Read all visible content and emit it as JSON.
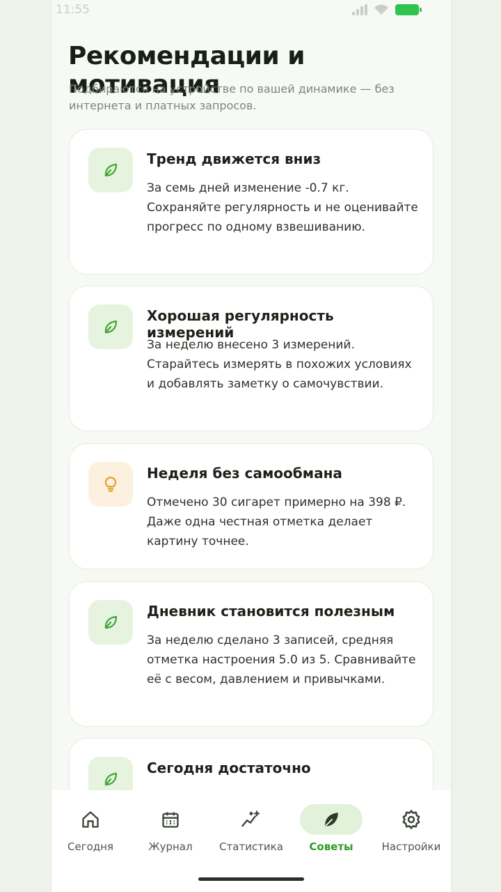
{
  "status": {
    "time": "11:55"
  },
  "page": {
    "title": "Рекомендации и мотивация",
    "subtitle": "Подбираются на устройстве по вашей динамике — без интернета и платных запросов."
  },
  "cards": [
    {
      "icon": "leaf-icon",
      "title": "Тренд движется вниз",
      "text": "За семь дней изменение -0.7 кг. Сохраняйте регулярность и не оценивайте прогресс по одному взвешиванию."
    },
    {
      "icon": "leaf-icon",
      "title": "Хорошая регулярность измерений",
      "text": "За неделю внесено 3 измерений. Старайтесь измерять в похожих условиях и добавлять заметку о самочувствии."
    },
    {
      "icon": "lightbulb-icon",
      "title": "Неделя без самообмана",
      "text": "Отмечено 30 сигарет примерно на 398 ₽. Даже одна честная отметка делает картину точнее."
    },
    {
      "icon": "leaf-icon",
      "title": "Дневник становится полезным",
      "text": "За неделю сделано 3 записей, средняя отметка настроения 5.0 из 5. Сравнивайте её с весом, давлением и привычками."
    },
    {
      "icon": "leaf-icon",
      "title": "Сегодня достаточно",
      "text": ""
    }
  ],
  "nav": [
    {
      "label": "Сегодня",
      "icon": "home-icon"
    },
    {
      "label": "Журнал",
      "icon": "calendar-icon"
    },
    {
      "label": "Статистика",
      "icon": "stats-icon"
    },
    {
      "label": "Советы",
      "icon": "leaf-icon",
      "active": true
    },
    {
      "label": "Настройки",
      "icon": "gear-icon"
    }
  ],
  "colors": {
    "accent": "#2f9a26",
    "accent_bg": "#e1f1da",
    "warm_bg": "#fcf0de",
    "warm_icon": "#e0a12a"
  }
}
